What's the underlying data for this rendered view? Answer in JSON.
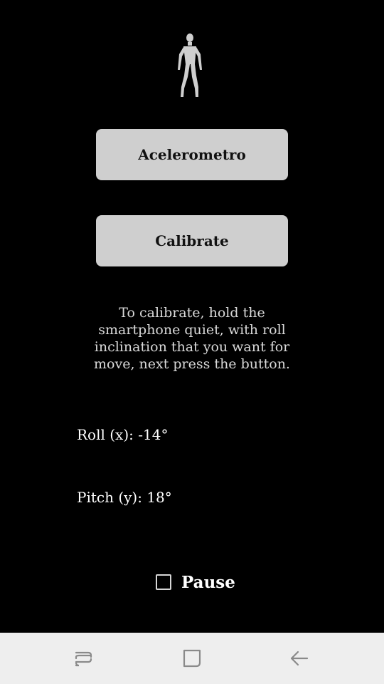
{
  "main": {
    "accelerometer_button": "Acelerometro",
    "calibrate_button": "Calibrate",
    "instructions": "To calibrate, hold the smartphone quiet, with roll inclination that you want for move, next press the button.",
    "roll_readout": "Roll (x): -14°",
    "pitch_readout": "Pitch (y): 18°",
    "pause_label": "Pause",
    "pause_checked": false
  },
  "icons": {
    "figure": "stick-figure-icon",
    "nav_recent": "recent-apps-icon",
    "nav_home": "home-icon",
    "nav_back": "back-arrow-icon"
  },
  "colors": {
    "background": "#000000",
    "button_bg": "#cfcfcf",
    "button_text": "#111111",
    "text": "#ffffff",
    "navbar_bg": "#eeeeee",
    "nav_icon": "#8a8a8a"
  }
}
